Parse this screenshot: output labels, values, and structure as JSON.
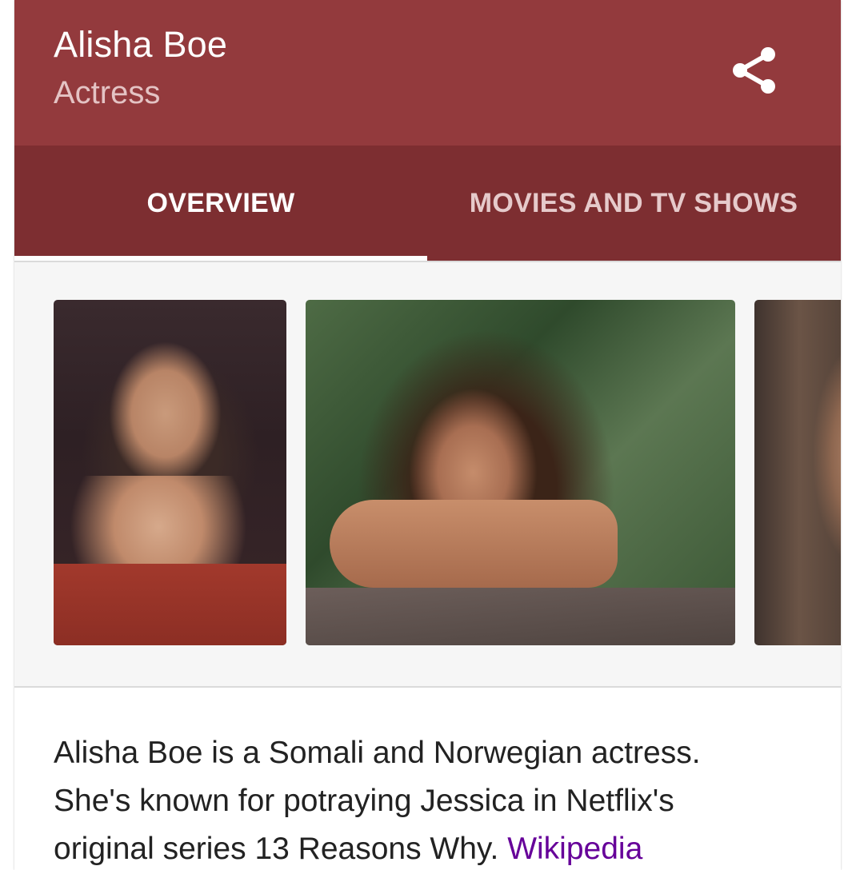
{
  "header": {
    "title": "Alisha Boe",
    "subtitle": "Actress",
    "share_icon": "share-icon",
    "background_color": "#933A3D"
  },
  "tabs": [
    {
      "label": "OVERVIEW",
      "selected": true
    },
    {
      "label": "MOVIES AND TV SHOWS",
      "selected": false
    }
  ],
  "tabs_background_color": "#7D2E31",
  "gallery": {
    "images": [
      {
        "description_name": "photo-1"
      },
      {
        "description_name": "photo-2"
      },
      {
        "description_name": "photo-3"
      }
    ]
  },
  "description": {
    "text": "Alisha Boe is a Somali and Norwegian actress. She's known for potraying Jessica in Netflix's original series 13 Reasons Why. ",
    "link_label": "Wikipedia",
    "link_color": "#660099"
  }
}
